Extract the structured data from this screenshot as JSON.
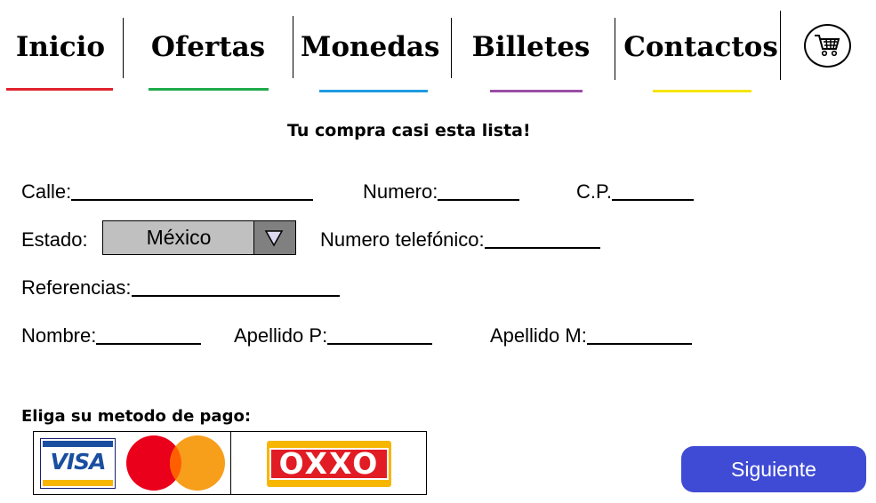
{
  "nav": {
    "items": [
      {
        "label": "Inicio",
        "color": "#e0232e"
      },
      {
        "label": "Ofertas",
        "color": "#1faa4a"
      },
      {
        "label": "Monedas",
        "color": "#1e9be0"
      },
      {
        "label": "Billetes",
        "color": "#9b4da6"
      },
      {
        "label": "Contactos",
        "color": "#f5e50c"
      }
    ],
    "cart_icon": "shopping-cart-icon"
  },
  "headline": "Tu compra casi esta lista!",
  "form": {
    "calle": {
      "label": "Calle:",
      "value": ""
    },
    "numero": {
      "label": "Numero:",
      "value": ""
    },
    "cp": {
      "label": "C.P.",
      "value": ""
    },
    "estado": {
      "label": "Estado:",
      "value": "México",
      "icon": "triangle-down-icon"
    },
    "telefono": {
      "label": "Numero telefónico:",
      "value": ""
    },
    "referencias": {
      "label": "Referencias:",
      "value": ""
    },
    "nombre": {
      "label": "Nombre:",
      "value": ""
    },
    "apellido_p": {
      "label": "Apellido P:",
      "value": ""
    },
    "apellido_m": {
      "label": "Apellido M:",
      "value": ""
    }
  },
  "payment": {
    "title": "Eliga su metodo de pago:",
    "visa": "VISA",
    "oxxo": "OXXO"
  },
  "next_button": "Siguiente",
  "colors": {
    "button": "#3f4bd4",
    "select_bg": "#c0c0c0",
    "select_arrow_bg": "#808080"
  }
}
